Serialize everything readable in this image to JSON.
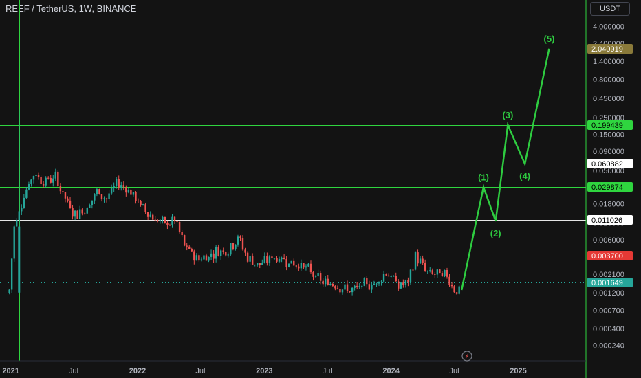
{
  "header": {
    "symbol_title": "REEF / TetherUS, 1W, BINANCE",
    "currency_button": "USDT"
  },
  "chart_data": {
    "type": "candlestick",
    "title": "REEF / TetherUS, 1W, BINANCE",
    "y_scale": "log",
    "ylim": [
      0.00015,
      9.0
    ],
    "x_range": [
      "2020-12-01",
      "2025-07-15"
    ],
    "y_tick_labels": [
      "4.000000",
      "2.400000",
      "1.400000",
      "0.800000",
      "0.450000",
      "0.250000",
      "0.150000",
      "0.090000",
      "0.050000",
      "0.030000",
      "0.018000",
      "0.010000",
      "0.006000",
      "0.003600",
      "0.002100",
      "0.001200",
      "0.000700",
      "0.000400",
      "0.000240"
    ],
    "x_tick_labels": [
      {
        "label": "2021",
        "date": "2021-01-01"
      },
      {
        "label": "Jul",
        "date": "2021-07-01"
      },
      {
        "label": "2022",
        "date": "2022-01-01"
      },
      {
        "label": "Jul",
        "date": "2022-07-01"
      },
      {
        "label": "2023",
        "date": "2023-01-01"
      },
      {
        "label": "Jul",
        "date": "2023-07-01"
      },
      {
        "label": "2024",
        "date": "2024-01-01"
      },
      {
        "label": "Jul",
        "date": "2024-07-01"
      },
      {
        "label": "2025",
        "date": "2025-01-01"
      }
    ],
    "horizontal_levels": [
      {
        "value": 2.040919,
        "label": "2.040919",
        "color": "#c8a24a",
        "tag_bg": "#8a7a3a",
        "tag_fg": "#ffffff"
      },
      {
        "value": 0.199439,
        "label": "0.199439",
        "color": "#2fd53f",
        "tag_bg": "#2fd53f",
        "tag_fg": "#000000"
      },
      {
        "value": 0.060882,
        "label": "0.060882",
        "color": "#e6e6e6",
        "tag_bg": "#ffffff",
        "tag_fg": "#000000"
      },
      {
        "value": 0.029874,
        "label": "0.029874",
        "color": "#2fd53f",
        "tag_bg": "#2fd53f",
        "tag_fg": "#000000"
      },
      {
        "value": 0.011026,
        "label": "0.011026",
        "color": "#e6e6e6",
        "tag_bg": "#ffffff",
        "tag_fg": "#000000"
      },
      {
        "value": 0.0037,
        "label": "0.003700",
        "color": "#e53935",
        "tag_bg": "#e53935",
        "tag_fg": "#ffffff"
      },
      {
        "value": 0.001649,
        "label": "0.001649",
        "color": "#26a69a",
        "tag_bg": "#26a69a",
        "tag_fg": "#ffffff",
        "dotted": true
      }
    ],
    "vertical_line": {
      "date": "2021-01-25",
      "color": "#2fd53f"
    },
    "price_path": [
      [
        "2020-12-28",
        0.0013
      ],
      [
        "2021-01-11",
        0.009
      ],
      [
        "2021-02-08",
        0.024
      ],
      [
        "2021-03-08",
        0.045
      ],
      [
        "2021-04-05",
        0.036
      ],
      [
        "2021-05-10",
        0.04
      ],
      [
        "2021-06-07",
        0.021
      ],
      [
        "2021-07-05",
        0.013
      ],
      [
        "2021-08-09",
        0.016
      ],
      [
        "2021-09-06",
        0.026
      ],
      [
        "2021-10-04",
        0.021
      ],
      [
        "2021-11-01",
        0.034
      ],
      [
        "2021-12-06",
        0.028
      ],
      [
        "2022-01-10",
        0.017
      ],
      [
        "2022-02-14",
        0.012
      ],
      [
        "2022-03-21",
        0.0095
      ],
      [
        "2022-04-18",
        0.011
      ],
      [
        "2022-05-16",
        0.005
      ],
      [
        "2022-06-20",
        0.0034
      ],
      [
        "2022-07-18",
        0.0036
      ],
      [
        "2022-08-15",
        0.0042
      ],
      [
        "2022-09-19",
        0.0045
      ],
      [
        "2022-10-17",
        0.0065
      ],
      [
        "2022-11-14",
        0.0034
      ],
      [
        "2022-12-19",
        0.0028
      ],
      [
        "2023-01-23",
        0.0035
      ],
      [
        "2023-02-20",
        0.0034
      ],
      [
        "2023-03-27",
        0.0029
      ],
      [
        "2023-04-24",
        0.0027
      ],
      [
        "2023-05-22",
        0.0021
      ],
      [
        "2023-06-19",
        0.0016
      ],
      [
        "2023-07-24",
        0.0016
      ],
      [
        "2023-08-21",
        0.0013
      ],
      [
        "2023-09-18",
        0.0013
      ],
      [
        "2023-10-16",
        0.0015
      ],
      [
        "2023-11-20",
        0.0016
      ],
      [
        "2023-12-18",
        0.0023
      ],
      [
        "2024-01-22",
        0.0015
      ],
      [
        "2024-02-19",
        0.0016
      ],
      [
        "2024-03-11",
        0.0037
      ],
      [
        "2024-04-15",
        0.0022
      ],
      [
        "2024-05-13",
        0.0021
      ],
      [
        "2024-06-10",
        0.002
      ],
      [
        "2024-07-08",
        0.0012
      ],
      [
        "2024-07-22",
        0.001649
      ]
    ],
    "wave_projection": [
      {
        "date": "2024-07-22",
        "value": 0.0013,
        "label": ""
      },
      {
        "date": "2024-09-23",
        "value": 0.029874,
        "label": "(1)"
      },
      {
        "date": "2024-10-28",
        "value": 0.0106,
        "label": "(2)"
      },
      {
        "date": "2024-12-02",
        "value": 0.199439,
        "label": "(3)"
      },
      {
        "date": "2025-01-20",
        "value": 0.060882,
        "label": "(4)"
      },
      {
        "date": "2025-03-31",
        "value": 2.040919,
        "label": "(5)"
      }
    ],
    "wave_color": "#2ecc40",
    "grid": false,
    "candle_colors": {
      "up": "#26a69a",
      "down": "#ef5350"
    }
  }
}
